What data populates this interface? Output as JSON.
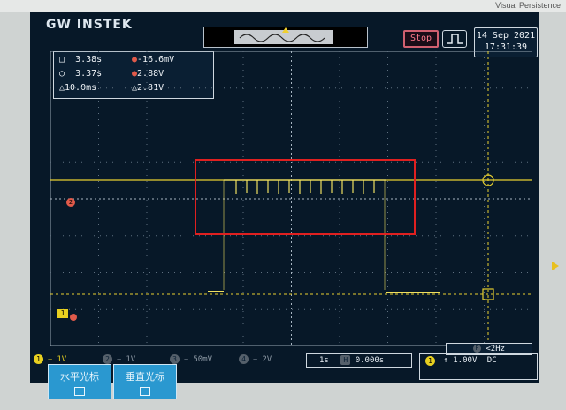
{
  "bezel": {
    "persistence_label": "Visual Persistence"
  },
  "header": {
    "brand": "GW INSTEK",
    "run_state": "Stop",
    "date": "14 Sep 2021",
    "time": "17:31:39"
  },
  "cursors": {
    "t1": "3.38s",
    "t2": "3.37s",
    "dt": "△10.0ms",
    "v1": "-16.6mV",
    "v2": "2.88V",
    "dv": "△2.81V"
  },
  "channels": {
    "ch1_scale": "1V",
    "ch2_scale": "1V",
    "ch3_scale": "50mV",
    "ch4_scale": "2V"
  },
  "timebase": {
    "scale": "1s",
    "position": "0.000s"
  },
  "trigger": {
    "level": "1.00V",
    "coupling": "DC",
    "frequency": "<2Hz"
  },
  "softkeys": [
    {
      "label": "水平光标"
    },
    {
      "label": "垂直光标"
    }
  ],
  "colors": {
    "ch1": "#e8d020",
    "ch2": "#e05a4a",
    "screen_bg": "#071828",
    "highlight": "#e02020"
  }
}
